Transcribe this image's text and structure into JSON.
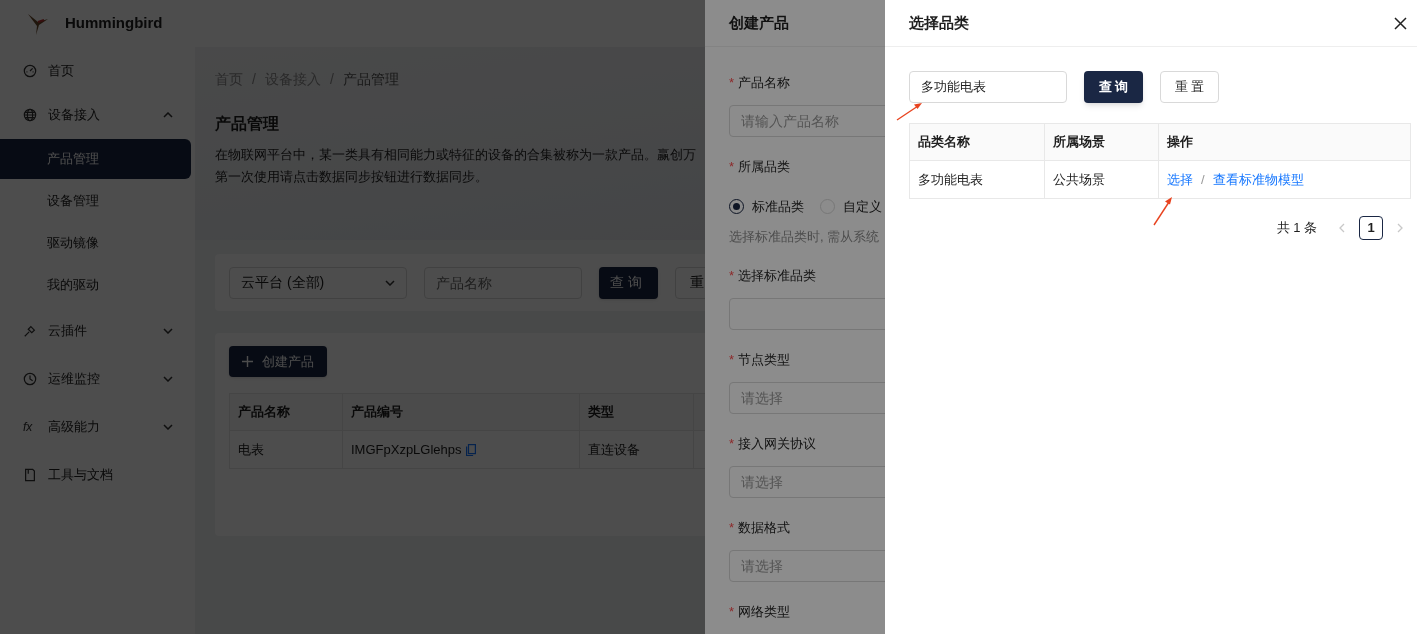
{
  "app": {
    "name": "Hummingbird"
  },
  "sidebar": {
    "items": [
      {
        "label": "首页",
        "kind": "dashboard",
        "selected": false
      },
      {
        "label": "设备接入",
        "kind": "globe",
        "selected": false,
        "expanded": true,
        "children": [
          {
            "label": "产品管理",
            "selected": true
          },
          {
            "label": "设备管理",
            "selected": false
          },
          {
            "label": "驱动镜像",
            "selected": false
          },
          {
            "label": "我的驱动",
            "selected": false
          }
        ]
      },
      {
        "label": "云插件",
        "kind": "plug",
        "selected": false,
        "expanded": false
      },
      {
        "label": "运维监控",
        "kind": "clock",
        "selected": false,
        "expanded": false
      },
      {
        "label": "高级能力",
        "kind": "fx",
        "glyph": "fx",
        "selected": false,
        "expanded": false
      },
      {
        "label": "工具与文档",
        "kind": "doc",
        "selected": false
      }
    ]
  },
  "main": {
    "breadcrumb": {
      "items": [
        "首页",
        "设备接入",
        "产品管理"
      ],
      "separator": "/"
    },
    "title": "产品管理",
    "description": [
      "在物联网平台中，某一类具有相同能力或特征的设备的合集被称为一款产品。赢创万",
      "第一次使用请点击数据同步按钮进行数据同步。"
    ],
    "filter": {
      "platform_select": {
        "value": "云平台 (全部)"
      },
      "name_field": {
        "placeholder": "产品名称"
      },
      "buttons": [
        {
          "label": "查询",
          "kind": "primary"
        },
        {
          "label": "重",
          "kind": "default"
        }
      ]
    },
    "create_button": {
      "label": "创建产品"
    },
    "table": {
      "columns": [
        "产品名称",
        "产品编号",
        "类型"
      ],
      "rows": [
        {
          "cells": [
            {
              "text": "电表",
              "copyable": false
            },
            {
              "text": "IMGFpXzpLGlehps",
              "copyable": true
            },
            {
              "text": "直连设备",
              "copyable": false
            }
          ]
        }
      ]
    }
  },
  "create_drawer": {
    "title": "创建产品",
    "fields": [
      {
        "label": "产品名称",
        "required_mark": "*",
        "kind": "input",
        "placeholder": "请输入产品名称"
      },
      {
        "label": "所属品类",
        "required_mark": "*",
        "kind": "radio",
        "options": [
          {
            "label": "标准品类",
            "selected": true
          },
          {
            "label": "自定义",
            "selected": false
          }
        ],
        "hint": "选择标准品类时, 需从系统"
      },
      {
        "label": "选择标准品类",
        "required_mark": "*",
        "kind": "select"
      },
      {
        "label": "节点类型",
        "required_mark": "*",
        "kind": "select",
        "placeholder": "请选择"
      },
      {
        "label": "接入网关协议",
        "required_mark": "*",
        "kind": "select",
        "placeholder": "请选择"
      },
      {
        "label": "数据格式",
        "required_mark": "*",
        "kind": "select",
        "placeholder": "请选择"
      },
      {
        "label": "网络类型",
        "required_mark": "*",
        "kind": "cut"
      }
    ]
  },
  "category_drawer": {
    "title": "选择品类",
    "search": {
      "value": "多功能电表"
    },
    "buttons": [
      {
        "label": "查询",
        "kind": "primary"
      },
      {
        "label": "重置",
        "kind": "default"
      }
    ],
    "table": {
      "columns": [
        "品类名称",
        "所属场景",
        "操作"
      ],
      "rows": [
        {
          "name": "多功能电表",
          "scene": "公共场景",
          "actions": [
            "选择",
            "查看标准物模型"
          ],
          "separator": "/"
        }
      ]
    },
    "pagination": {
      "total": "共 1 条",
      "prev_disabled": true,
      "next_disabled": true,
      "pages": [
        {
          "label": "1",
          "selected": true
        }
      ]
    }
  }
}
